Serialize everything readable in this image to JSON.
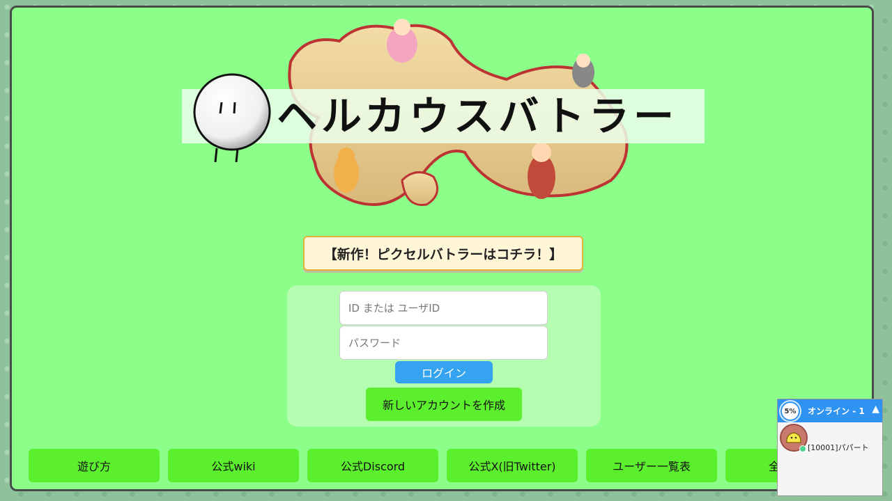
{
  "title": {
    "logo_text": "ヘルカウスバトラー"
  },
  "banner": {
    "label": "【新作！ピクセルバトラーはコチラ！】"
  },
  "login": {
    "id_placeholder": "ID または ユーザID",
    "password_placeholder": "パスワード",
    "login_label": "ログイン",
    "create_label": "新しいアカウントを作成"
  },
  "nav": {
    "items": [
      {
        "label": "遊び方"
      },
      {
        "label": "公式wiki"
      },
      {
        "label": "公式Discord"
      },
      {
        "label": "公式X(旧Twitter)"
      },
      {
        "label": "ユーザー一覧表"
      },
      {
        "label": "全カード"
      }
    ]
  },
  "online_widget": {
    "percent": "5%",
    "title": "オンライン - 1",
    "collapse_icon": "caret-up-icon",
    "users": [
      {
        "name": "[10001]パパート",
        "status_color": "#4cd28f"
      }
    ]
  },
  "colors": {
    "background": "#8cfe8a",
    "button_green": "#5cef2e",
    "login_blue": "#36a3f0",
    "widget_blue": "#2f93f2"
  }
}
